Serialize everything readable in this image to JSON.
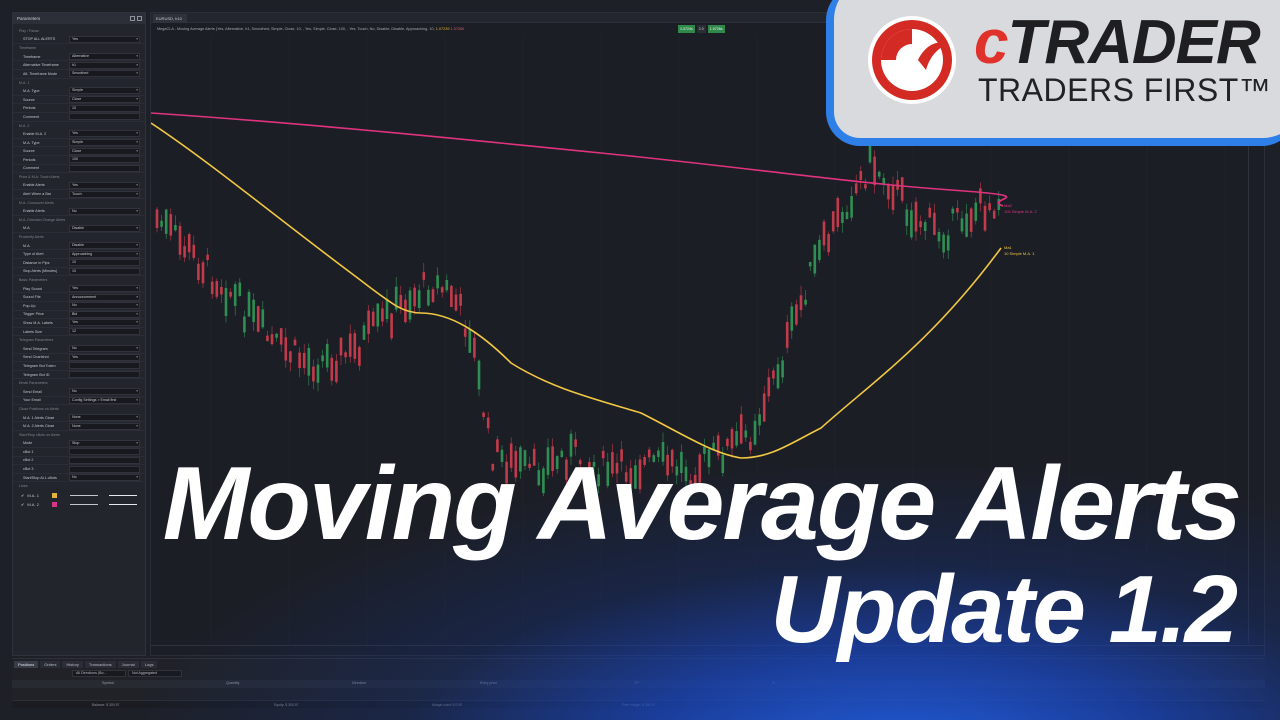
{
  "params": {
    "title": "Parameters",
    "sections": [
      {
        "header": "Play / Pause",
        "rows": [
          {
            "label": "STOP ALL ALERTS",
            "value": "Yes"
          }
        ]
      },
      {
        "header": "Timeframe",
        "rows": [
          {
            "label": "Timeframe",
            "value": "Alternative"
          },
          {
            "label": "Alternative Timeframe",
            "value": "h1"
          },
          {
            "label": "Alt. Timeframe Mode",
            "value": "Smoothed"
          }
        ]
      },
      {
        "header": "M.A. 1",
        "rows": [
          {
            "label": "M.A. Type",
            "value": "Simple"
          },
          {
            "label": "Source",
            "value": "Close"
          },
          {
            "label": "Periods",
            "value": "10"
          },
          {
            "label": "Comment",
            "value": ""
          }
        ]
      },
      {
        "header": "M.A. 2",
        "rows": [
          {
            "label": "Enable M.A. 2",
            "value": "Yes"
          },
          {
            "label": "M.A. Type",
            "value": "Simple"
          },
          {
            "label": "Source",
            "value": "Close"
          },
          {
            "label": "Periods",
            "value": "100"
          },
          {
            "label": "Comment",
            "value": ""
          }
        ]
      },
      {
        "header": "Price & M.A. Touch Alerts",
        "rows": [
          {
            "label": "Enable Alerts",
            "value": "Yes"
          },
          {
            "label": "Alert When a Bar",
            "value": "Touch"
          }
        ]
      },
      {
        "header": "M.A. Crossover Alerts",
        "rows": [
          {
            "label": "Enable Alerts",
            "value": "No"
          }
        ]
      },
      {
        "header": "M.A. Direction Change Alerts",
        "rows": [
          {
            "label": "M.A.",
            "value": "Disable"
          }
        ]
      },
      {
        "header": "Proximity Alerts",
        "rows": [
          {
            "label": "M.A.",
            "value": "Disable"
          },
          {
            "label": "Type of Alert",
            "value": "Approaching"
          },
          {
            "label": "Distance in Pips",
            "value": "10"
          },
          {
            "label": "Stop Alerts (Minutes)",
            "value": "10"
          }
        ]
      },
      {
        "header": "Basic Parameters",
        "rows": [
          {
            "label": "Play Sound",
            "value": "Yes"
          },
          {
            "label": "Sound File",
            "value": "Announcement"
          },
          {
            "label": "Pop-Up",
            "value": "No"
          },
          {
            "label": "Trigger Price",
            "value": "Bid"
          },
          {
            "label": "Show M.A. Labels",
            "value": "Yes"
          },
          {
            "label": "Labels Size",
            "value": "12"
          }
        ]
      },
      {
        "header": "Telegram Parameters",
        "rows": [
          {
            "label": "Send Telegram",
            "value": "No"
          },
          {
            "label": "Send Chartshot",
            "value": "Yes"
          },
          {
            "label": "Telegram Bot Token",
            "value": ""
          },
          {
            "label": "Telegram Bot ID",
            "value": ""
          }
        ]
      },
      {
        "header": "Email Parameters",
        "rows": [
          {
            "label": "Send Email",
            "value": "No"
          },
          {
            "label": "Your Email",
            "value": "Config Settings > Email first"
          }
        ]
      },
      {
        "header": "Close Positions on Alerts",
        "rows": [
          {
            "label": "M.A. 1 Alerts Close",
            "value": "None"
          },
          {
            "label": "M.A. 2 Alerts Close",
            "value": "None"
          }
        ]
      },
      {
        "header": "Start/Stop cBots on Alerts",
        "rows": [
          {
            "label": "Mode",
            "value": "Stop"
          },
          {
            "label": "cBot 1",
            "value": ""
          },
          {
            "label": "cBot 2",
            "value": ""
          },
          {
            "label": "cBot 3",
            "value": ""
          },
          {
            "label": "Start/Stop ALL cBots",
            "value": "No"
          }
        ]
      }
    ],
    "lines_header": "Lines",
    "lines": [
      {
        "label": "M.A. 1",
        "color": "#e3b339"
      },
      {
        "label": "M.A. 2",
        "color": "#d9338a"
      }
    ]
  },
  "chart": {
    "tab": "EURUSD, h10",
    "info": "MegaCLA - Moving Average Alerts (Yes, Alternative, h1, Smoothed, Simple, Close, 10, , Yes, Simple, Close, 100, , Yes, Touch, No, Disable, Disable, Approaching, 10,",
    "bid": "1.07239",
    "ask": "1.07260",
    "trade_sell": "1.0724s",
    "trade_mid": "2.0",
    "trade_buy": "1.0726s",
    "ma2_label": "Ma2",
    "ma2_desc": "100 Simple M.A. 2",
    "ma1_label": "Ma1",
    "ma1_desc": "10 Simple M.A. 1",
    "ma1_color": "#f2c744",
    "ma2_color": "#e0337f",
    "bull_color": "#2f8f52",
    "bear_color": "#c23b4a"
  },
  "bottom": {
    "tabs": [
      "Positions",
      "Orders",
      "History",
      "Transactions",
      "Journal",
      "Logs"
    ],
    "filters": [
      "All Directions (Bo...",
      "Not Aggregated"
    ],
    "columns": [
      "Symbol",
      "Quantity",
      "Direction",
      "Entry price",
      "TP",
      "SL"
    ],
    "footer": [
      "Balance: $ 300.97",
      "Equity: $ 300.97",
      "Margin used: $ 0.00",
      "Free margin: $ 300.97"
    ]
  },
  "headline": {
    "line1": "Moving Average Alerts",
    "line2": "Update 1.2"
  },
  "logo": {
    "brand_c": "c",
    "brand_rest": "TRADER",
    "slogan": "TRADERS FIRST™"
  }
}
